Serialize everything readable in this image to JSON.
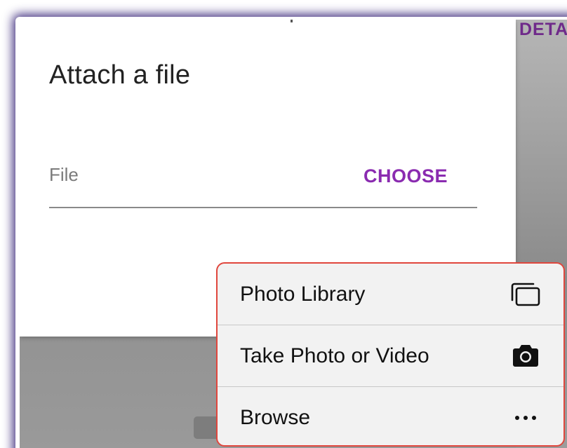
{
  "background": {
    "details_label": "DETA"
  },
  "dialog": {
    "title": "Attach a file",
    "file_label": "File",
    "choose_label": "CHOOSE"
  },
  "menu": {
    "items": [
      {
        "label": "Photo Library",
        "icon": "photo-library-icon"
      },
      {
        "label": "Take Photo or Video",
        "icon": "camera-icon"
      },
      {
        "label": "Browse",
        "icon": "ellipsis-icon"
      }
    ]
  },
  "colors": {
    "accent": "#8a2bb0",
    "menu_highlight_border": "#e0463d",
    "frame_shadow": "#28146e"
  }
}
